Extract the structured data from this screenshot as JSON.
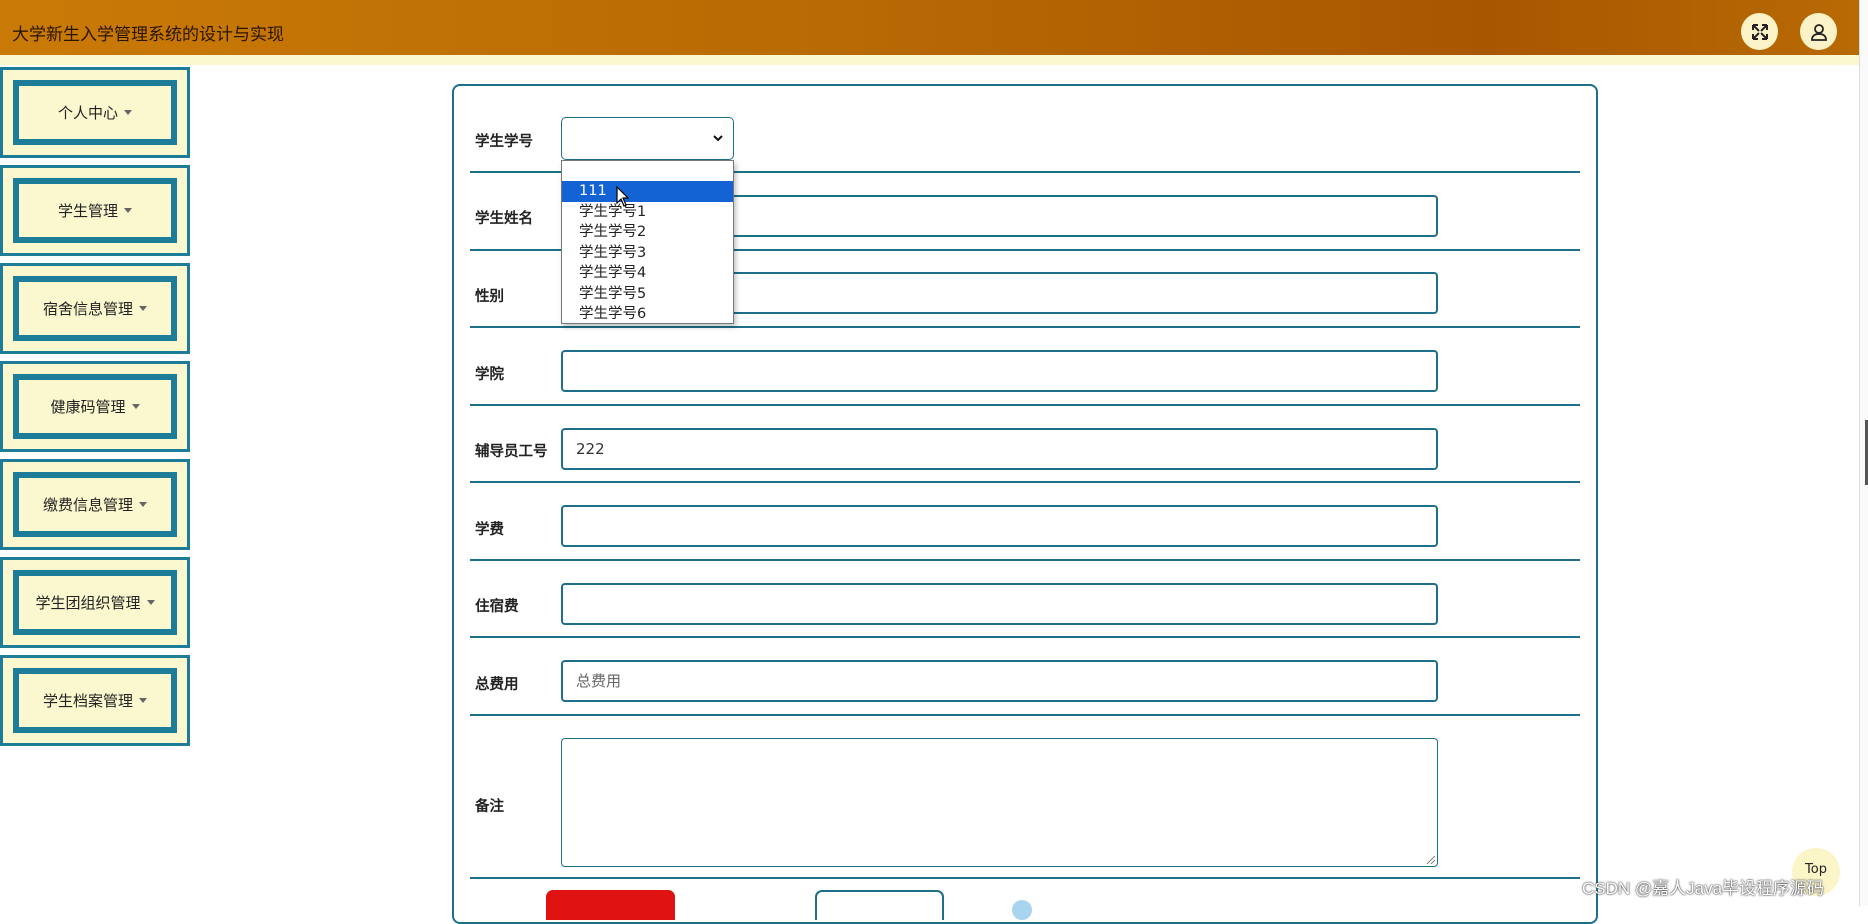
{
  "header": {
    "title": "大学新生入学管理系统的设计与实现",
    "fullscreen_icon": "expand-icon",
    "user_icon": "user-icon"
  },
  "sidebar": {
    "items": [
      {
        "label": "个人中心"
      },
      {
        "label": "学生管理"
      },
      {
        "label": "宿舍信息管理"
      },
      {
        "label": "健康码管理"
      },
      {
        "label": "缴费信息管理"
      },
      {
        "label": "学生团组织管理"
      },
      {
        "label": "学生档案管理"
      }
    ]
  },
  "form": {
    "student_id": {
      "label": "学生学号",
      "value": "",
      "options": [
        "",
        "111",
        "学生学号1",
        "学生学号2",
        "学生学号3",
        "学生学号4",
        "学生学号5",
        "学生学号6"
      ],
      "highlighted": "111"
    },
    "student_name": {
      "label": "学生姓名",
      "value": ""
    },
    "gender": {
      "label": "性别",
      "value": ""
    },
    "college": {
      "label": "学院",
      "value": ""
    },
    "counselor_id": {
      "label": "辅导员工号",
      "value": "222"
    },
    "tuition": {
      "label": "学费",
      "value": ""
    },
    "dorm_fee": {
      "label": "住宿费",
      "value": ""
    },
    "total_fee": {
      "label": "总费用",
      "placeholder": "总费用",
      "value": ""
    },
    "remarks": {
      "label": "备注",
      "value": ""
    }
  },
  "top_button": {
    "label": "Top"
  },
  "watermark": "CSDN @嘉人Java毕设程序源码",
  "colors": {
    "header": "#b86a04",
    "menu_bg": "#fbf8cf",
    "border": "#1d6f8a",
    "danger": "#e11212",
    "selected": "#1463d4"
  }
}
